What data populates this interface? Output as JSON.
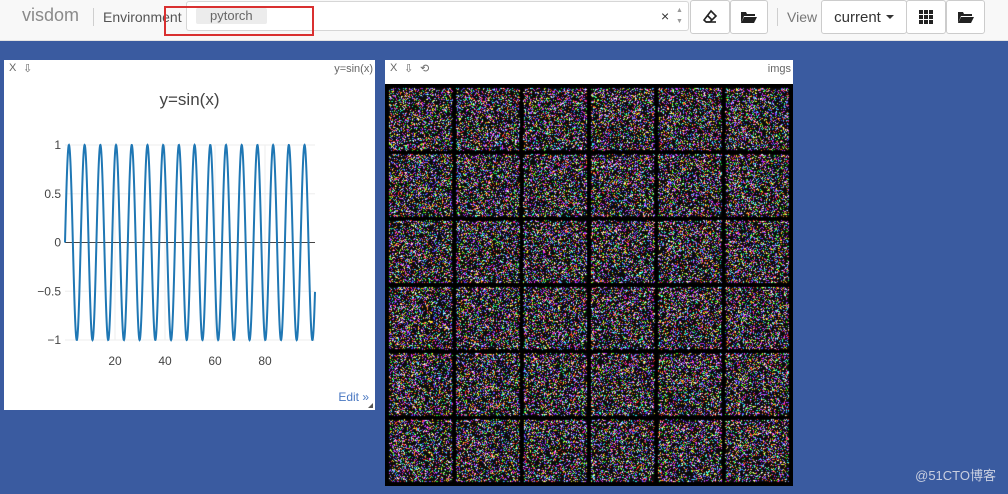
{
  "navbar": {
    "brand": "visdom",
    "environment_label": "Environment",
    "environment_tag": "pytorch",
    "clear_symbol": "×",
    "view_label": "View",
    "view_select": "current"
  },
  "panes": {
    "plot": {
      "close_label": "X",
      "download_symbol": "⇩",
      "window_title": "y=sin(x)",
      "edit_link": "Edit »"
    },
    "images": {
      "close_label": "X",
      "download_symbol": "⇩",
      "refresh_symbol": "⟲",
      "window_title": "imgs",
      "grid": {
        "rows": 6,
        "cols": 6
      }
    }
  },
  "chart_data": {
    "type": "line",
    "title": "y=sin(x)",
    "xlabel": "",
    "ylabel": "",
    "xlim": [
      0,
      100
    ],
    "ylim": [
      -1,
      1
    ],
    "x_ticks": [
      "20",
      "40",
      "60",
      "80"
    ],
    "y_ticks": [
      "1",
      "0.5",
      "0",
      "−0.5",
      "−1"
    ],
    "series": [
      {
        "function": "sin(x)",
        "x_start": 0,
        "x_end": 100,
        "color": "#1f77b4"
      }
    ]
  },
  "watermark": "@51CTO博客",
  "colors": {
    "background": "#3a5ba0",
    "navbar": "#f8f8f8",
    "highlight": "#d93030",
    "line": "#1f77b4",
    "link": "#4a78c2"
  }
}
